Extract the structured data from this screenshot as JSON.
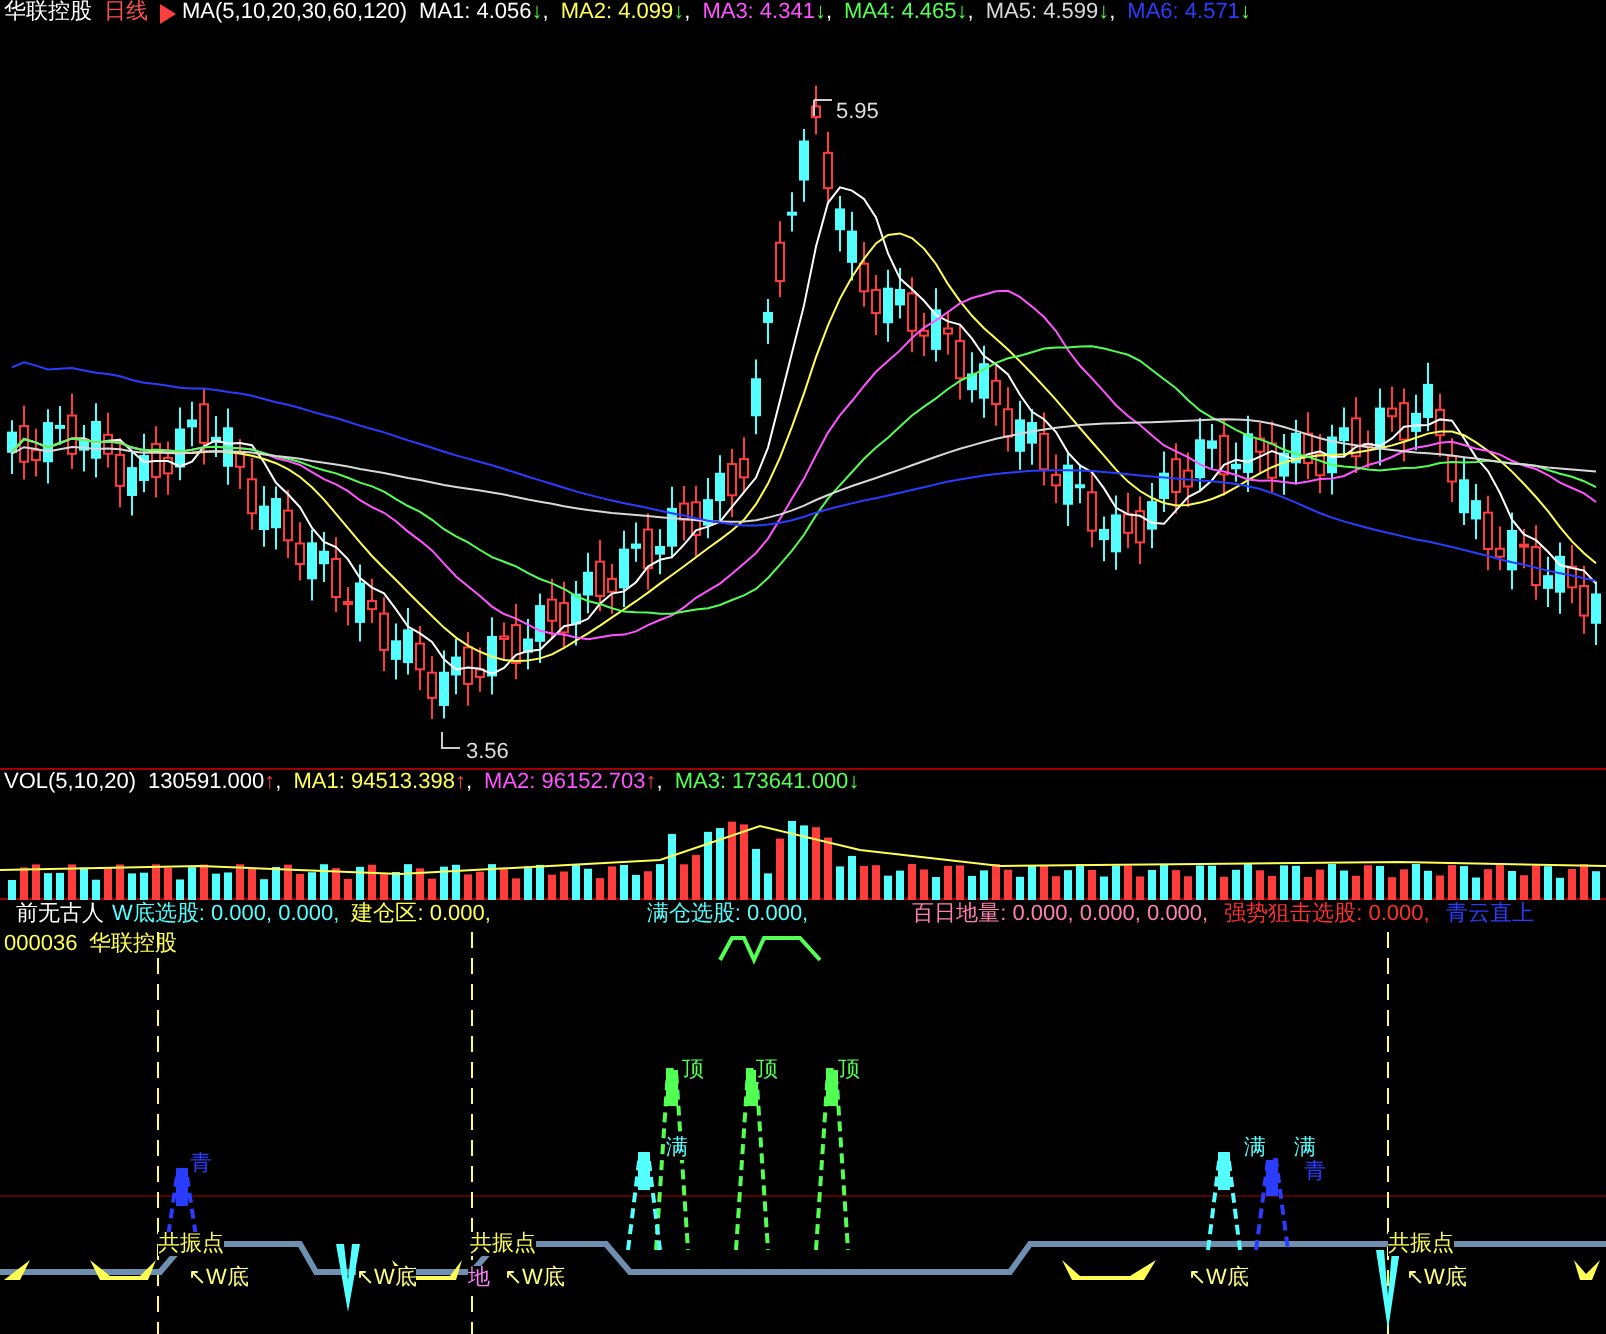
{
  "price_panel": {
    "title": "华联控股",
    "period": "日线",
    "indicator": "MA(5,10,20,30,60,120)",
    "readings": [
      {
        "label": "MA1:",
        "value": "4.056",
        "arrow": "↓",
        "rising": false,
        "suffix": ",",
        "color": "#ffffff"
      },
      {
        "label": "MA2:",
        "value": "4.099",
        "arrow": "↓",
        "rising": false,
        "suffix": ",",
        "color": "#ffff54"
      },
      {
        "label": "MA3:",
        "value": "4.341",
        "arrow": "↓",
        "rising": false,
        "suffix": ",",
        "color": "#ff54ff"
      },
      {
        "label": "MA4:",
        "value": "4.465",
        "arrow": "↓",
        "rising": false,
        "suffix": ",",
        "color": "#54ff54"
      },
      {
        "label": "MA5:",
        "value": "4.599",
        "arrow": "↓",
        "rising": false,
        "suffix": ",",
        "color": "#d8d8d8"
      },
      {
        "label": "MA6:",
        "value": "4.571",
        "arrow": "↓",
        "rising": false,
        "color": "#2a3cff"
      }
    ],
    "high_label": "5.95",
    "low_label": "3.56"
  },
  "volume_panel": {
    "indicator": "VOL(5,10,20)",
    "readings": [
      {
        "value": "130591.000",
        "arrow": "↑",
        "rising": true,
        "suffix": ",",
        "color": "#ffffff"
      },
      {
        "label": "MA1:",
        "value": "94513.398",
        "arrow": "↑",
        "rising": true,
        "suffix": ",",
        "color": "#ffff54"
      },
      {
        "label": "MA2:",
        "value": "96152.703",
        "arrow": "↑",
        "rising": true,
        "suffix": ",",
        "color": "#ff54ff"
      },
      {
        "label": "MA3:",
        "value": "173641.000",
        "arrow": "↓",
        "rising": false,
        "color": "#54ff54"
      }
    ]
  },
  "signal_panel": {
    "readings": [
      {
        "text": "前无古人",
        "color": "#ffffff"
      },
      {
        "text": "W底选股: 0.000, 0.000,",
        "color": "#54ffff"
      },
      {
        "text": "建仓区: 0.000,",
        "color": "#ffff54"
      },
      {
        "text": "满仓选股: 0.000,",
        "color": "#54ffff"
      },
      {
        "text": "百日地量: 0.000, 0.000, 0.000,",
        "color": "#ff80b0"
      },
      {
        "text": "强势狙击选股: 0.000,",
        "color": "#ff3030"
      },
      {
        "text": "青云直上",
        "color": "#2a3cff"
      }
    ],
    "code": "000036",
    "name": "华联控股",
    "markers": [
      {
        "text": "青",
        "color": "#2a3cff"
      },
      {
        "text": "共振点",
        "color": "#ffff54"
      },
      {
        "text": "↖W底",
        "color": "#ffff80"
      },
      {
        "text": "↖W底",
        "color": "#ffff80"
      },
      {
        "text": "共振点",
        "color": "#ffff54"
      },
      {
        "text": "地",
        "color": "#ff80ff"
      },
      {
        "text": "↖W底",
        "color": "#ffff80"
      },
      {
        "text": "满",
        "color": "#54ffff"
      },
      {
        "text": "顶",
        "color": "#54ff54"
      },
      {
        "text": "顶",
        "color": "#54ff54"
      },
      {
        "text": "顶",
        "color": "#54ff54"
      },
      {
        "text": "满",
        "color": "#54ffff"
      },
      {
        "text": "满",
        "color": "#54ffff"
      },
      {
        "text": "青",
        "color": "#2a3cff"
      },
      {
        "text": "↖W底",
        "color": "#ffff80"
      },
      {
        "text": "共振点",
        "color": "#ffff54"
      },
      {
        "text": "↖W底",
        "color": "#ffff80"
      }
    ]
  }
}
